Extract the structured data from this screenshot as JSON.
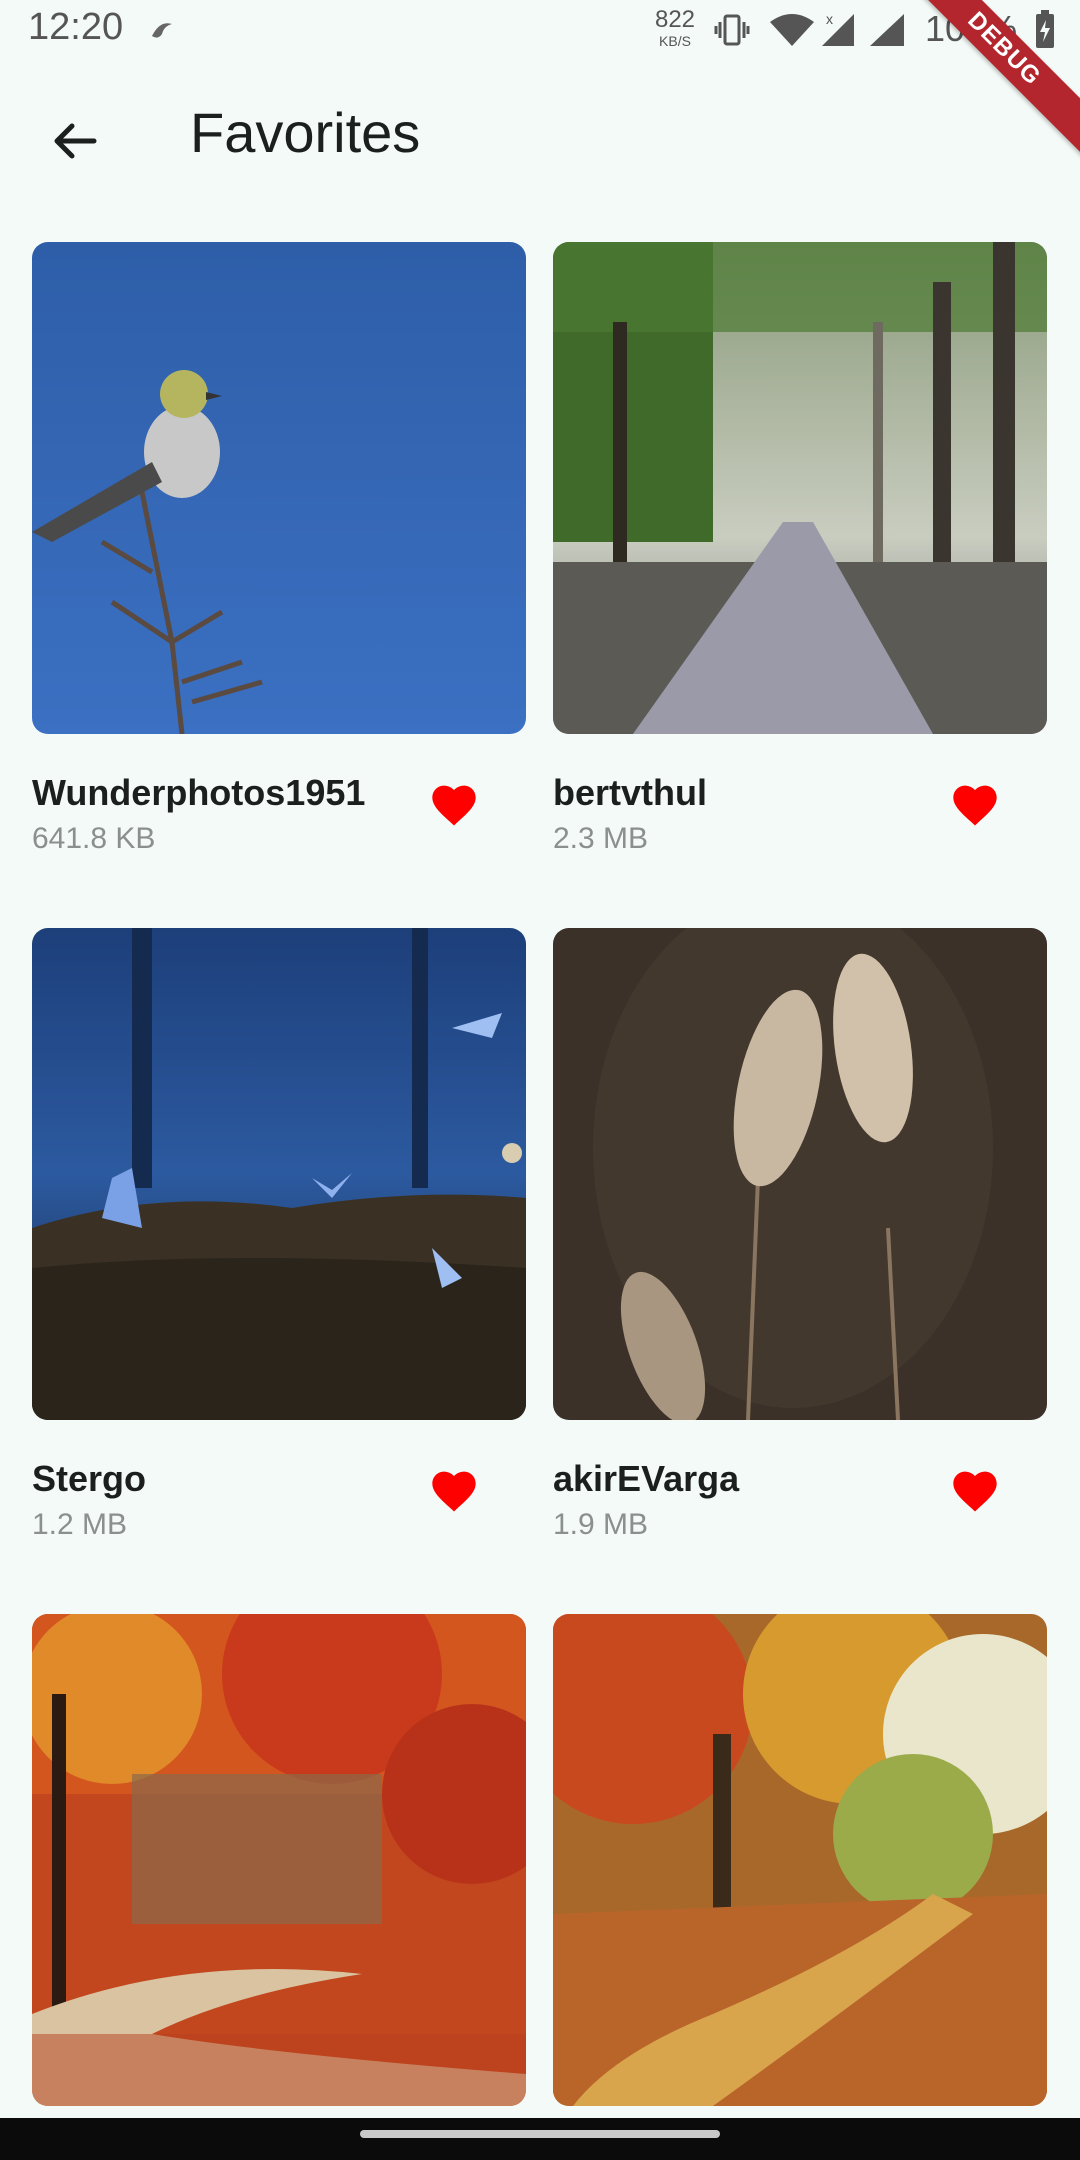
{
  "status_bar": {
    "time": "12:20",
    "net_speed_value": "822",
    "net_speed_unit": "KB/S",
    "battery_text": "100%",
    "icons": [
      "app-notification-icon",
      "vibrate-icon",
      "wifi-icon",
      "signal-x-icon",
      "signal-icon",
      "battery-charging-icon"
    ]
  },
  "debug_banner": "DEBUG",
  "app_bar": {
    "back_icon": "arrow-back-icon",
    "title": "Favorites"
  },
  "favorites": [
    {
      "author": "Wunderphotos1951",
      "size": "641.8 KB",
      "favorited": true
    },
    {
      "author": "bertvthul",
      "size": "2.3 MB",
      "favorited": true
    },
    {
      "author": "Stergo",
      "size": "1.2 MB",
      "favorited": true
    },
    {
      "author": "akirEVarga",
      "size": "1.9 MB",
      "favorited": true
    },
    {
      "author": "",
      "size": "",
      "favorited": true
    },
    {
      "author": "",
      "size": "",
      "favorited": true
    }
  ],
  "colors": {
    "background": "#f3faf8",
    "heart": "#ff0000",
    "secondary_text": "#8b8f8e",
    "debug_ribbon": "#b3262d"
  }
}
